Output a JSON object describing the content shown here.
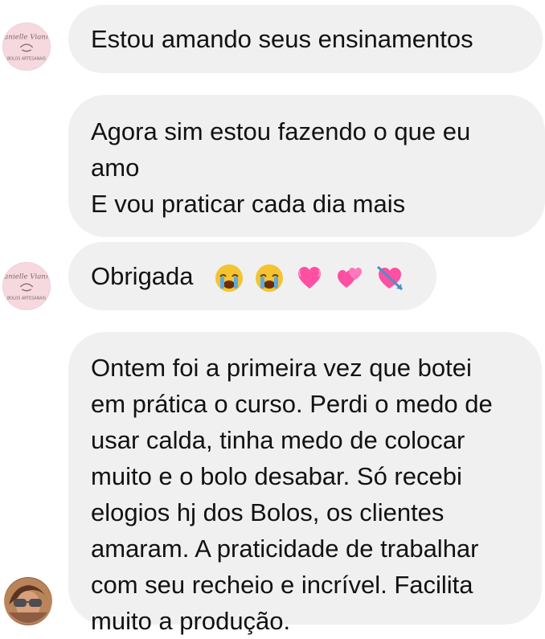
{
  "avatars": {
    "brand_lines": [
      "Danielle Vianna",
      "BOLOS ARTESANAIS"
    ]
  },
  "messages": [
    {
      "lines": [
        "Estou amando seus ensinamentos"
      ]
    },
    {
      "lines": [
        "Agora sim estou fazendo o que eu",
        "amo",
        "E vou praticar cada dia mais"
      ]
    },
    {
      "text": "Obrigada",
      "emoji_icons": [
        "crying-face-icon",
        "crying-face-icon",
        "pink-heart-icon",
        "two-hearts-icon",
        "heart-with-arrow-icon"
      ]
    },
    {
      "lines": [
        "Ontem foi a primeira vez que botei",
        "em prática o curso. Perdi o medo de",
        "usar calda, tinha medo de colocar",
        "muito e o bolo desabar. Só recebi",
        "elogios hj dos Bolos, os clientes",
        "amaram. A praticidade de trabalhar",
        "com seu recheio e incrível. Facilita",
        "muito a produção."
      ]
    }
  ],
  "colors": {
    "bubble_background": "#f0f0f0",
    "text": "#121212",
    "logo_pink": "#f6d9df",
    "emoji_yellow": "#f4c430",
    "emoji_blue": "#5aa9e6",
    "emoji_pink": "#ff4fa3"
  }
}
